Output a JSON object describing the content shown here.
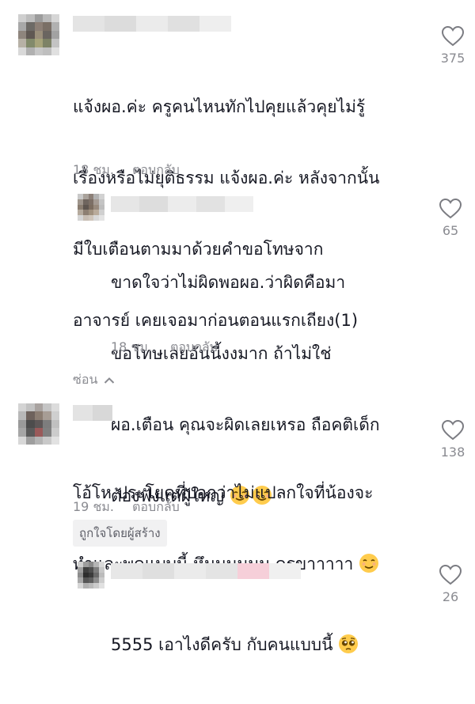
{
  "comments": [
    {
      "text_lines": [
        "แจ้งผอ.ค่ะ ครูคนไหนทักไปคุยแล้วคุยไม่รู้",
        "เรื่องหรือไม่ยุติธรรม แจ้งผอ.ค่ะ หลังจากนั้น",
        "มีใบเตือนตามมาด้วยคำขอโทษจาก",
        "อาจารย์ เคยเจอมาก่อนตอนแรกเถียง(1)"
      ],
      "time": "18 ชม.",
      "reply_label": "ตอบกลับ",
      "likes": "375"
    },
    {
      "text_lines": [
        "ขาดใจว่าไม่ผิดพอผอ.ว่าผิดคือมา",
        "ขอโทษเลยอันนี้งงมาก ถ้าไม่ใช่",
        "ผอ.เตือน คุณจะผิดเลยเหรอ ถือคติเด็ก",
        "ต้องฟังแต่ผู้ใหญ่ "
      ],
      "time": "18 ชม.",
      "reply_label": "ตอบกลับ",
      "likes": "65"
    },
    {
      "text_lines": [
        "โอ้โห ประโยคที่บอกว่าไม่แปลกใจที่น้องจะ",
        "ทำและพูดแบบนี้ หึมมมมมม ครูขาาาาา "
      ],
      "time": "19 ชม.",
      "reply_label": "ตอบกลับ",
      "likes": "138",
      "creator_badge": "ถูกใจโดยผู้สร้าง"
    },
    {
      "text_lines": [
        "5555 เอาไงดีครับ กับคนแบบนี้ "
      ],
      "likes": "26"
    }
  ],
  "hide_replies_label": "ซ่อน",
  "icons": {
    "like": "heart-outline-icon",
    "relieved": "relieved-face-emoji",
    "pleading": "pleading-face-emoji",
    "chevron": "chevron-up-icon"
  },
  "colors": {
    "text": "#161823",
    "meta": "#8a8b91",
    "badge_bg": "#f1f1f2"
  }
}
